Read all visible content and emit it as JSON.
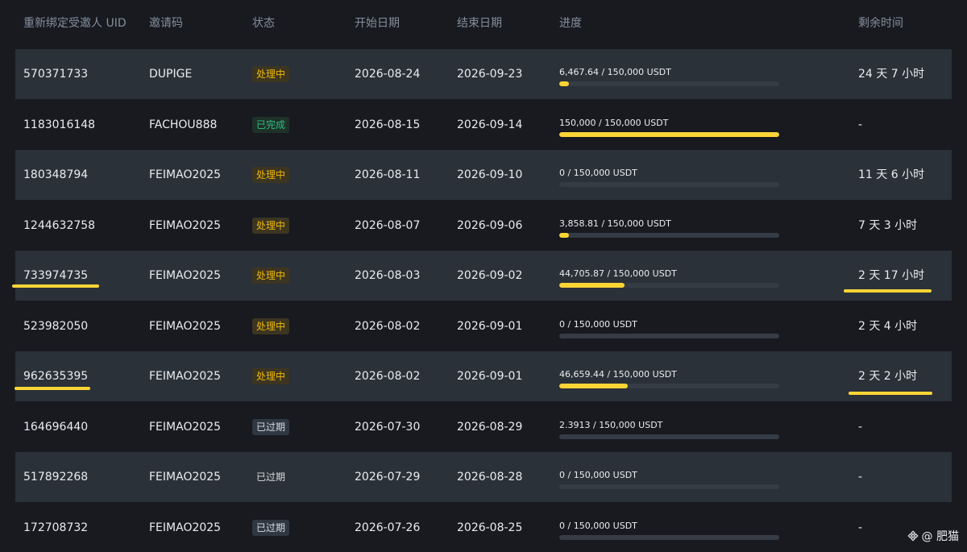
{
  "table": {
    "headers": {
      "uid": "重新绑定受邀人 UID",
      "code": "邀请码",
      "status": "状态",
      "start": "开始日期",
      "end": "结束日期",
      "progress": "进度",
      "remaining": "剩余时间"
    },
    "rows": [
      {
        "uid": "570371733",
        "code": "DUPIGE",
        "status": "处理中",
        "status_type": "processing",
        "start": "2026-08-24",
        "end": "2026-09-23",
        "progress_text": "6,467.64 / 150,000 USDT",
        "progress_fraction": 0.0431,
        "remaining": "24 天 7 小时"
      },
      {
        "uid": "1183016148",
        "code": "FACHOU888",
        "status": "已完成",
        "status_type": "completed",
        "start": "2026-08-15",
        "end": "2026-09-14",
        "progress_text": "150,000 / 150,000 USDT",
        "progress_fraction": 1.0,
        "remaining": "-"
      },
      {
        "uid": "180348794",
        "code": "FEIMAO2025",
        "status": "处理中",
        "status_type": "processing",
        "start": "2026-08-11",
        "end": "2026-09-10",
        "progress_text": "0 / 150,000 USDT",
        "progress_fraction": 0,
        "remaining": "11 天 6 小时"
      },
      {
        "uid": "1244632758",
        "code": "FEIMAO2025",
        "status": "处理中",
        "status_type": "processing",
        "start": "2026-08-07",
        "end": "2026-09-06",
        "progress_text": "3,858.81 / 150,000 USDT",
        "progress_fraction": 0.0257,
        "remaining": "7 天 3 小时"
      },
      {
        "uid": "733974735",
        "code": "FEIMAO2025",
        "status": "处理中",
        "status_type": "processing",
        "start": "2026-08-03",
        "end": "2026-09-02",
        "progress_text": "44,705.87 / 150,000 USDT",
        "progress_fraction": 0.298,
        "remaining": "2 天 17 小时"
      },
      {
        "uid": "523982050",
        "code": "FEIMAO2025",
        "status": "处理中",
        "status_type": "processing",
        "start": "2026-08-02",
        "end": "2026-09-01",
        "progress_text": "0 / 150,000 USDT",
        "progress_fraction": 0,
        "remaining": "2 天 4 小时"
      },
      {
        "uid": "962635395",
        "code": "FEIMAO2025",
        "status": "处理中",
        "status_type": "processing",
        "start": "2026-08-02",
        "end": "2026-09-01",
        "progress_text": "46,659.44 / 150,000 USDT",
        "progress_fraction": 0.311,
        "remaining": "2 天 2 小时"
      },
      {
        "uid": "164696440",
        "code": "FEIMAO2025",
        "status": "已过期",
        "status_type": "expired",
        "start": "2026-07-30",
        "end": "2026-08-29",
        "progress_text": "2.3913 / 150,000 USDT",
        "progress_fraction": 0,
        "remaining": "-"
      },
      {
        "uid": "517892268",
        "code": "FEIMAO2025",
        "status": "已过期",
        "status_type": "expired-plain",
        "start": "2026-07-29",
        "end": "2026-08-28",
        "progress_text": "0 / 150,000 USDT",
        "progress_fraction": 0,
        "remaining": "-"
      },
      {
        "uid": "172708732",
        "code": "FEIMAO2025",
        "status": "已过期",
        "status_type": "expired",
        "start": "2026-07-26",
        "end": "2026-08-25",
        "progress_text": "0 / 150,000 USDT",
        "progress_fraction": 0,
        "remaining": "-"
      }
    ]
  },
  "watermark": {
    "icon": "binance-diamond-icon",
    "text": "@ 肥猫"
  },
  "colors": {
    "accent": "#fcd535",
    "processing": "#f0b90b",
    "completed": "#2ebd85",
    "row_shade": "#2b3139",
    "background": "#181a20"
  }
}
